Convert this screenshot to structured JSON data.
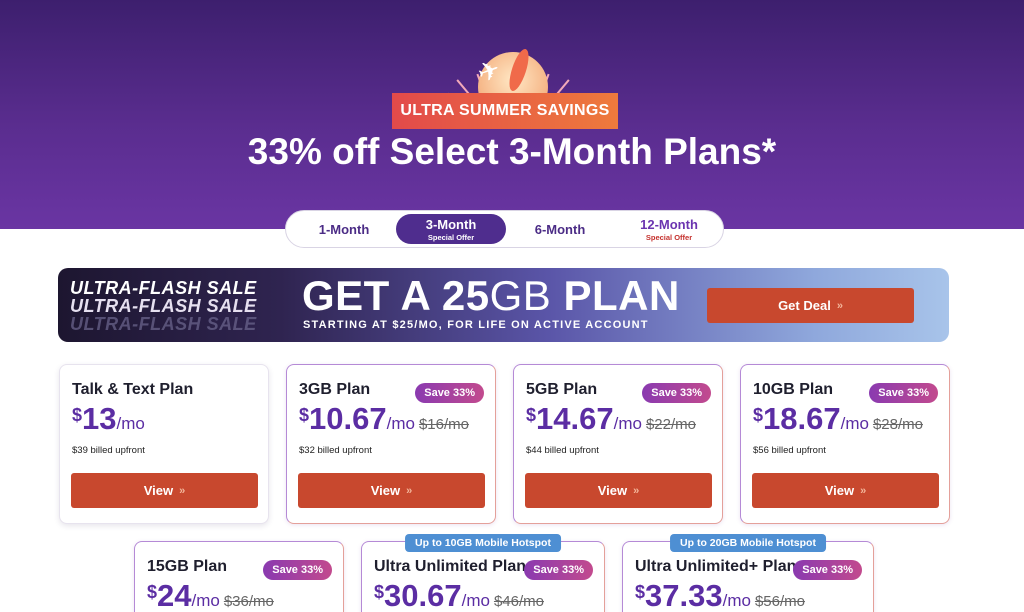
{
  "hero": {
    "badge": "ULTRA SUMMER SAVINGS",
    "headline": "33% off Select 3-Month Plans*",
    "icons": [
      "sun-icon",
      "airplane-icon",
      "surfboard-icon"
    ]
  },
  "tabs": [
    {
      "label": "1-Month",
      "sub": "",
      "active": false
    },
    {
      "label": "3-Month",
      "sub": "Special Offer",
      "active": true
    },
    {
      "label": "6-Month",
      "sub": "",
      "active": false
    },
    {
      "label": "12-Month",
      "sub": "Special Offer",
      "active": false
    }
  ],
  "flash": {
    "line1": "ULTRA-FLASH SALE",
    "line2": "ULTRA-FLASH SALE",
    "line3": "ULTRA-FLASH SALE",
    "big_pre": "GET A 25",
    "big_unit": "GB",
    "big_post": " PLAN",
    "small": "STARTING AT $25/MO, FOR LIFE ON ACTIVE ACCOUNT",
    "button": "Get Deal"
  },
  "chevron": "»",
  "currency": "$",
  "per": "/mo",
  "plans": [
    {
      "name": "Talk & Text Plan",
      "price": "13",
      "old": "",
      "save": "",
      "billed": "$39 billed upfront",
      "view": "View",
      "hotspot": ""
    },
    {
      "name": "3GB Plan",
      "price": "10.67",
      "old": "$16/mo",
      "save": "Save 33%",
      "billed": "$32 billed upfront",
      "view": "View",
      "hotspot": ""
    },
    {
      "name": "5GB Plan",
      "price": "14.67",
      "old": "$22/mo",
      "save": "Save 33%",
      "billed": "$44 billed upfront",
      "view": "View",
      "hotspot": ""
    },
    {
      "name": "10GB Plan",
      "price": "18.67",
      "old": "$28/mo",
      "save": "Save 33%",
      "billed": "$56 billed upfront",
      "view": "View",
      "hotspot": ""
    },
    {
      "name": "15GB Plan",
      "price": "24",
      "old": "$36/mo",
      "save": "Save 33%",
      "billed": "",
      "view": "",
      "hotspot": ""
    },
    {
      "name": "Ultra Unlimited Plan",
      "price": "30.67",
      "old": "$46/mo",
      "save": "Save 33%",
      "billed": "",
      "view": "",
      "hotspot": "Up to 10GB Mobile Hotspot"
    },
    {
      "name": "Ultra Unlimited+ Plan",
      "price": "37.33",
      "old": "$56/mo",
      "save": "Save 33%",
      "billed": "",
      "view": "",
      "hotspot": "Up to 20GB Mobile Hotspot"
    }
  ]
}
